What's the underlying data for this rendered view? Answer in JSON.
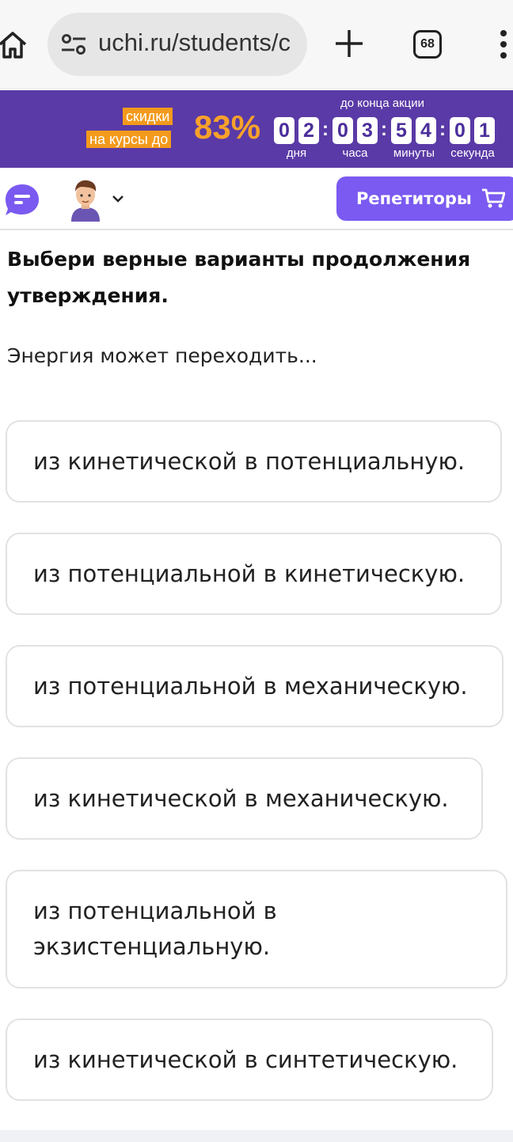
{
  "browser": {
    "url": "uchi.ru/students/c",
    "tab_count": "68",
    "icons": [
      "home-icon",
      "site-settings-icon",
      "new-tab-icon",
      "tabs-icon",
      "more-icon"
    ]
  },
  "promo": {
    "tag_line1": "скидки",
    "tag_line2": "на курсы до",
    "percent": "83%",
    "until_label": "до конца акции",
    "digits": [
      "0",
      "2",
      "0",
      "3",
      "5",
      "4",
      "0",
      "1"
    ],
    "units": {
      "days": "дня",
      "hours": "часа",
      "minutes": "минуты",
      "seconds": "секунда"
    },
    "colors": {
      "background": "#5a3aa6",
      "accent": "#f39a1c"
    }
  },
  "header": {
    "tutors_label": "Репетиторы",
    "icons": [
      "chat-icon",
      "avatar",
      "chevron-down-icon",
      "cart-icon"
    ],
    "accent_color": "#7a5af0"
  },
  "task": {
    "question": "Выбери верные варианты продолжения утверждения.",
    "statement": "Энергия может переходить...",
    "options": [
      "из кинетической в потенциальную.",
      "из потенциальной в кинетическую.",
      "из потенциальной в механическую.",
      "из кинетической в механическую.",
      "из потенциальной в экзистенциальную.",
      "из кинетической в синтетическую."
    ]
  }
}
